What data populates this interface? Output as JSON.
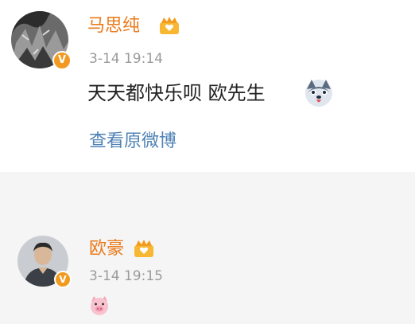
{
  "comments": [
    {
      "author": "马思纯",
      "time": "3-14 19:14",
      "text": "天天都快乐呗 欧先生",
      "emoji": "husky-dog-emoji",
      "link": "查看原微博",
      "verified_badge": "V"
    },
    {
      "author": "欧豪",
      "time": "3-14 19:15",
      "emoji": "pig-emoji",
      "verified_badge": "V"
    }
  ],
  "colors": {
    "name": "#ea7a19",
    "time": "#9b9b9b",
    "link": "#4f82b5",
    "badge": "#f29a1f",
    "divider_bg": "#f5f5f5"
  }
}
